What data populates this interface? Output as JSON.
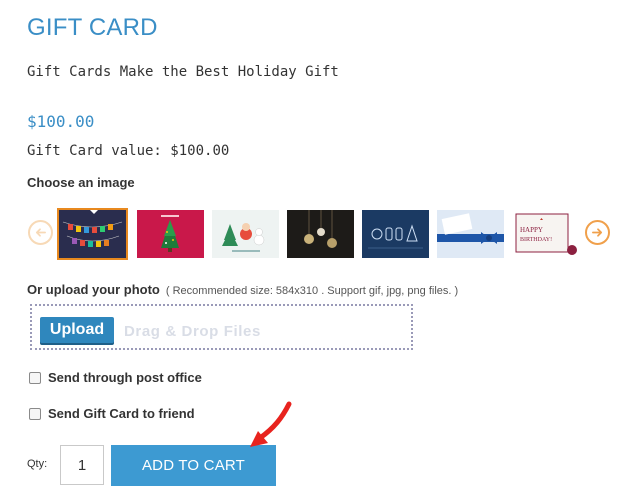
{
  "product": {
    "title": "GIFT CARD",
    "subtitle": "Gift Cards Make the Best Holiday Gift",
    "price": "$100.00",
    "value_label": "Gift Card value:",
    "value_amount": "$100.00"
  },
  "images": {
    "heading": "Choose an image",
    "prev_icon": "arrow-left-icon",
    "next_icon": "arrow-right-icon",
    "thumbnails": [
      {
        "name": "merry-christmas-banner",
        "selected": true
      },
      {
        "name": "christmas-tree-red"
      },
      {
        "name": "santa-snowman-card"
      },
      {
        "name": "ornaments-dark"
      },
      {
        "name": "blue-ornaments"
      },
      {
        "name": "happy-holidays-blue-ribbon"
      },
      {
        "name": "happy-birthday-card"
      }
    ]
  },
  "upload": {
    "label": "Or upload your photo",
    "hint": "( Recommended size: 584x310 .   Support gif, jpg, png files. )",
    "button_label": "Upload",
    "drop_text": "Drag & Drop Files"
  },
  "options": {
    "post_office": "Send through post office",
    "friend": "Send Gift Card to friend"
  },
  "cart": {
    "qty_label": "Qty:",
    "qty_value": "1",
    "add_label": "ADD TO CART"
  },
  "colors": {
    "accent": "#3a8ec6",
    "button": "#3d9ad2",
    "selected_border": "#e8891f",
    "annotation": "#e8231e"
  }
}
